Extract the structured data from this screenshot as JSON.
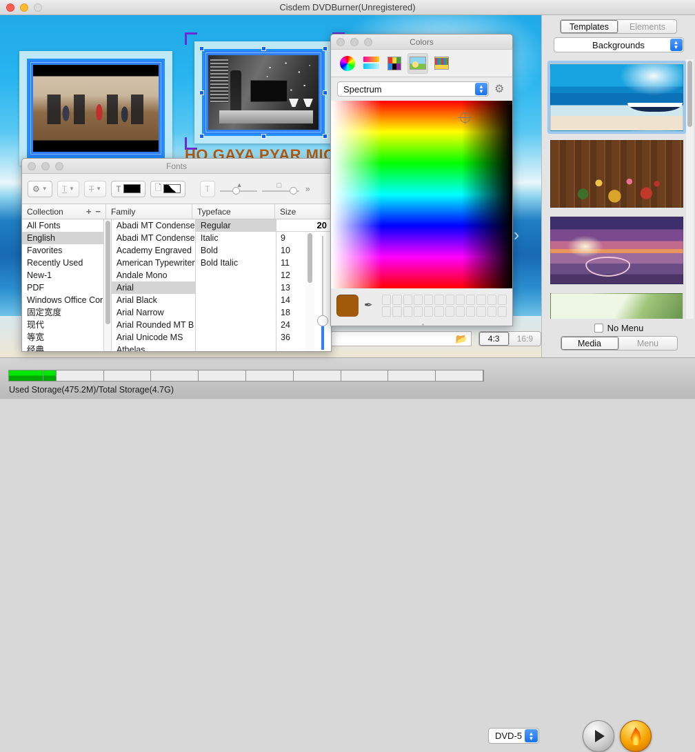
{
  "window": {
    "title": "Cisdem DVDBurner(Unregistered)"
  },
  "canvas": {
    "menu_title": "HO GAYA PYAR MICKE",
    "next_arrow_glyph": "›"
  },
  "fonts_panel": {
    "title": "Fonts",
    "toolbar": {
      "gear_label": "⚙",
      "underline_label": "T",
      "strikethrough_label": "T̶",
      "text_color_label": "T",
      "doc_color_label": "⬚",
      "shadow_label": "T",
      "more_label": "»"
    },
    "headers": {
      "collection": "Collection",
      "family": "Family",
      "typeface": "Typeface",
      "size": "Size",
      "add": "+",
      "remove": "−"
    },
    "collections": [
      "All Fonts",
      "English",
      "Favorites",
      "Recently Used",
      "New-1",
      "PDF",
      "Windows Office Cor",
      "固定宽度",
      "现代",
      "等宽",
      "经典"
    ],
    "collection_selected": "English",
    "families": [
      "Abadi MT Condense",
      "Abadi MT Condense",
      "Academy Engraved",
      "American Typewriter",
      "Andale Mono",
      "Arial",
      "Arial Black",
      "Arial Narrow",
      "Arial Rounded MT B",
      "Arial Unicode MS",
      "Athelas"
    ],
    "family_selected": "Arial",
    "typefaces": [
      "Regular",
      "Italic",
      "Bold",
      "Bold Italic"
    ],
    "typeface_selected": "Regular",
    "size_value": "20",
    "sizes": [
      "9",
      "10",
      "11",
      "12",
      "13",
      "14",
      "18",
      "24",
      "36"
    ]
  },
  "colors_panel": {
    "title": "Colors",
    "modes": [
      {
        "name": "color-wheel",
        "active": false
      },
      {
        "name": "color-sliders",
        "active": false
      },
      {
        "name": "color-palettes",
        "active": false
      },
      {
        "name": "image-palettes",
        "active": true
      },
      {
        "name": "pencils",
        "active": false
      }
    ],
    "picker_mode": "Spectrum",
    "current_color": "#a05a0a",
    "gear_glyph": "⚙",
    "eyedropper_glyph": "✒",
    "swatch_count": 24
  },
  "file_row": {
    "path_value": "",
    "folder_glyph": "📂",
    "aspect_options": [
      "4:3",
      "16:9"
    ],
    "aspect_selected": "4:3"
  },
  "sidebar": {
    "tabs": [
      "Templates",
      "Elements"
    ],
    "tab_selected": "Templates",
    "category": "Backgrounds",
    "backgrounds": [
      {
        "name": "beach-boat",
        "selected": true
      },
      {
        "name": "wood-garden-tools",
        "selected": false
      },
      {
        "name": "purple-sunset-heart",
        "selected": false
      },
      {
        "name": "green-leaves",
        "selected": false
      }
    ],
    "no_menu_label": "No Menu",
    "no_menu_checked": false,
    "mode_options": [
      "Media",
      "Menu"
    ],
    "mode_selected": "Media"
  },
  "bottom_bar": {
    "storage_label": "Used Storage(475.2M)/Total Storage(4.7G)",
    "storage_used_percent": 10,
    "disc_type": "DVD-5",
    "play_glyph": "▶",
    "burn_glyph": "flame-icon"
  }
}
